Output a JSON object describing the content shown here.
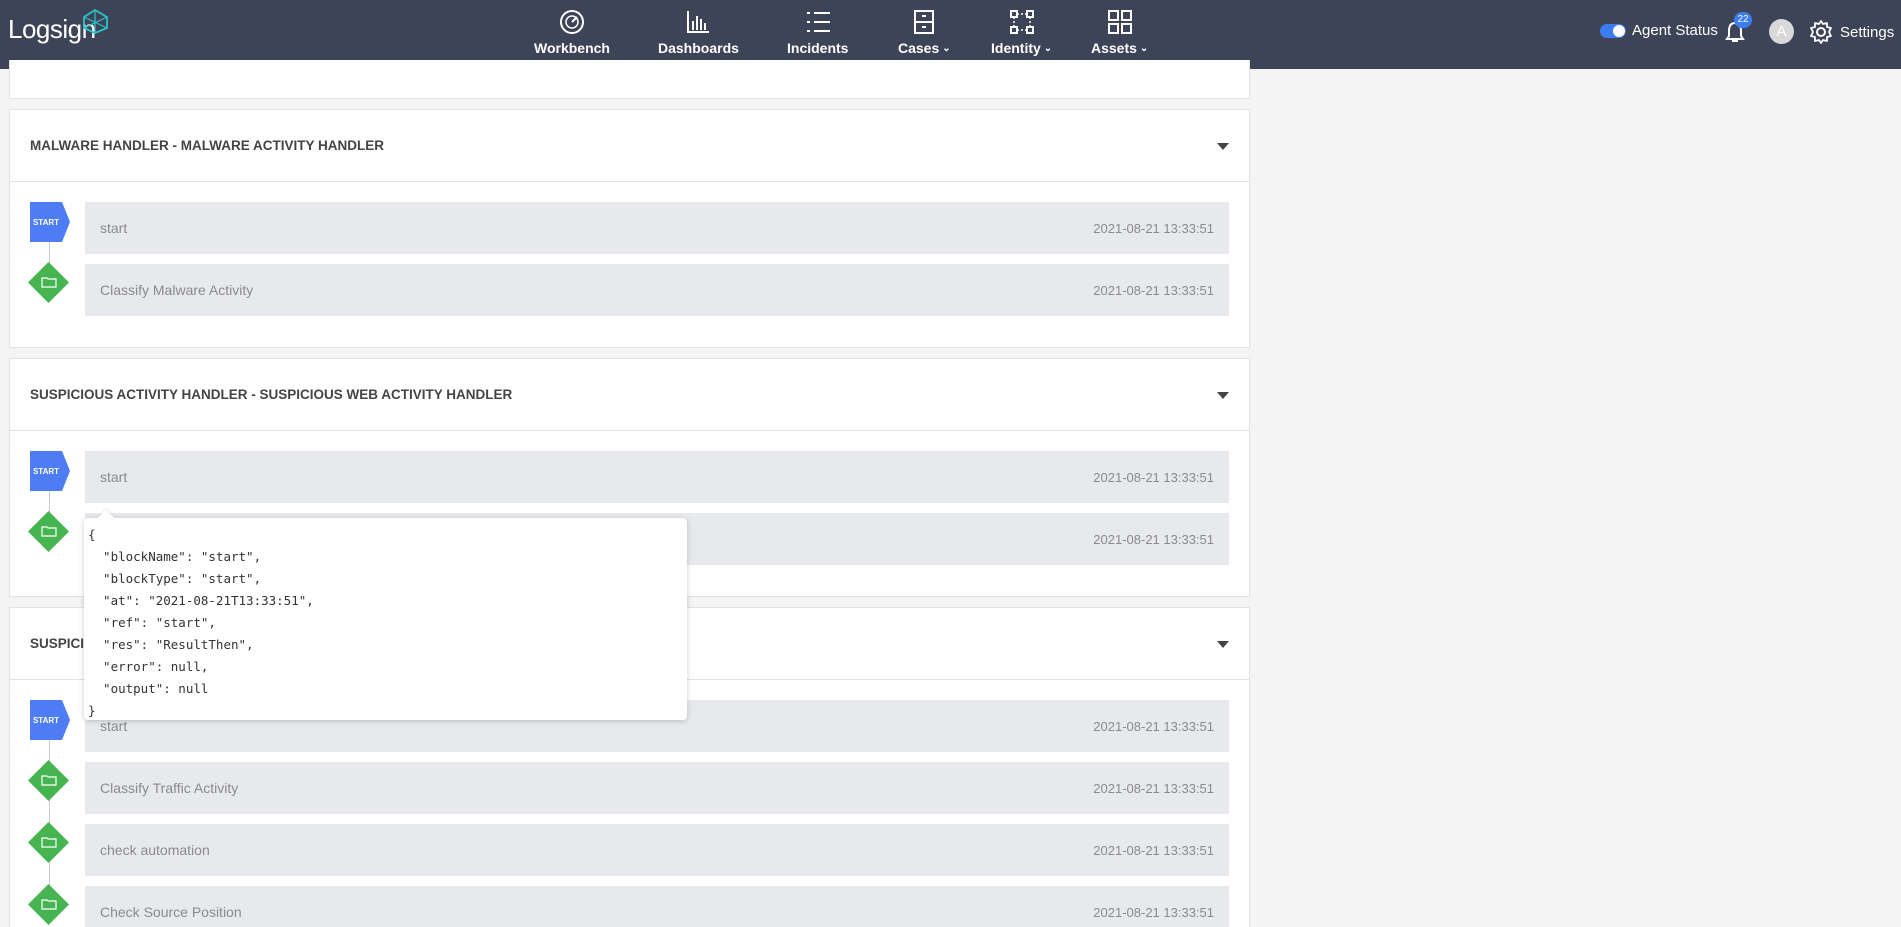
{
  "brand": {
    "name": "Logsign"
  },
  "nav": [
    {
      "label": "Workbench",
      "icon": "gauge-icon",
      "dropdown": false
    },
    {
      "label": "Dashboards",
      "icon": "bar-chart-icon",
      "dropdown": false
    },
    {
      "label": "Incidents",
      "icon": "list-icon",
      "dropdown": false
    },
    {
      "label": "Cases",
      "icon": "cabinet-icon",
      "dropdown": true
    },
    {
      "label": "Identity",
      "icon": "network-icon",
      "dropdown": true
    },
    {
      "label": "Assets",
      "icon": "grid-icon",
      "dropdown": true
    }
  ],
  "header_right": {
    "agent_status_label": "Agent Status",
    "agent_status_on": true,
    "notification_count": "22",
    "avatar_letter": "A",
    "settings_label": "Settings"
  },
  "panels": [
    {
      "title": "MALWARE HANDLER - MALWARE ACTIVITY HANDLER",
      "steps": [
        {
          "type": "start",
          "name": "start",
          "time": "2021-08-21 13:33:51"
        },
        {
          "type": "action",
          "name": "Classify Malware Activity",
          "time": "2021-08-21 13:33:51"
        }
      ]
    },
    {
      "title": "SUSPICIOUS ACTIVITY HANDLER - SUSPICIOUS WEB ACTIVITY HANDLER",
      "steps": [
        {
          "type": "start",
          "name": "start",
          "time": "2021-08-21 13:33:51"
        },
        {
          "type": "action",
          "name": "",
          "time": "2021-08-21 13:33:51"
        }
      ]
    },
    {
      "title": "SUSPICIO",
      "steps": [
        {
          "type": "start",
          "name": "start",
          "time": "2021-08-21 13:33:51"
        },
        {
          "type": "action",
          "name": "Classify Traffic Activity",
          "time": "2021-08-21 13:33:51"
        },
        {
          "type": "action",
          "name": "check automation",
          "time": "2021-08-21 13:33:51"
        },
        {
          "type": "action",
          "name": "Check Source Position",
          "time": "2021-08-21 13:33:51"
        }
      ]
    }
  ],
  "start_tag_label": "START",
  "tooltip_lines": [
    "{",
    "  \"blockName\": \"start\",",
    "  \"blockType\": \"start\",",
    "  \"at\": \"2021-08-21T13:33:51\",",
    "  \"ref\": \"start\",",
    "  \"res\": \"ResultThen\",",
    "  \"error\": null,",
    "  \"output\": null",
    "}"
  ],
  "colors": {
    "topbar": "#3e4458",
    "accent": "#3b7cf0",
    "start_tag": "#4d7cf5",
    "action_node": "#46b551"
  }
}
